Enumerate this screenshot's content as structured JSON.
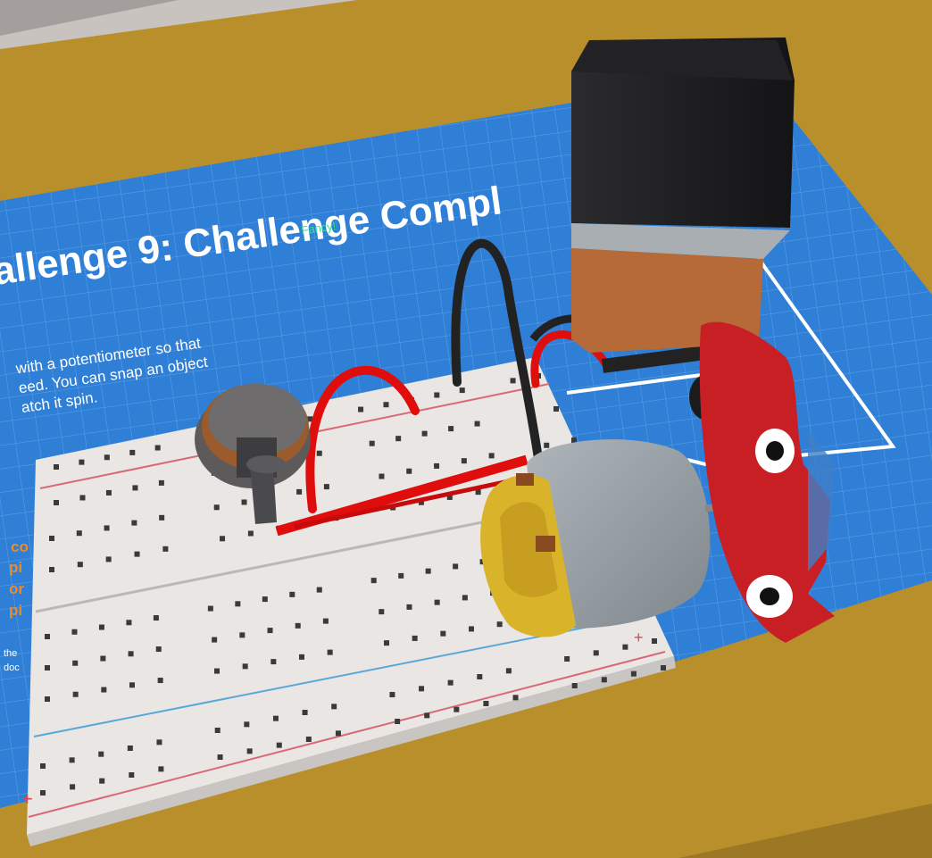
{
  "mat": {
    "title": "allenge 9: Challenge Compl",
    "subtitle": "Fancy!",
    "instruction_lines": [
      "with a potentiometer so that",
      "eed. You can snap an object",
      "atch it spin."
    ],
    "side_lines": [
      "co",
      "pi",
      "or",
      "pi"
    ],
    "footer_lines": [
      "the",
      "doc"
    ]
  },
  "colors": {
    "table": "#b98f2c",
    "mat": "#2f7fd6",
    "wire_red": "#e00d0d",
    "wire_black": "#222222",
    "battery_body": "#1d1d1f",
    "battery_cap": "#b56a38",
    "motor_body": "#8f979d",
    "motor_cap": "#d9b42a",
    "car": "#c81f24",
    "subtitle": "#2ee68a",
    "side_text": "#f28a1f"
  },
  "objects": [
    {
      "name": "breadboard",
      "label": ""
    },
    {
      "name": "potentiometer",
      "label": ""
    },
    {
      "name": "battery-9v",
      "label": ""
    },
    {
      "name": "dc-motor",
      "label": ""
    },
    {
      "name": "toy-car",
      "label": ""
    }
  ]
}
